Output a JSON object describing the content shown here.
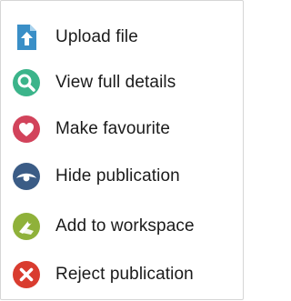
{
  "menu": {
    "items": [
      {
        "label": "Upload file",
        "icon": "upload-file-icon",
        "color": "#3a8fc7"
      },
      {
        "label": "View full details",
        "icon": "magnifier-icon",
        "color": "#3bb48a"
      },
      {
        "label": "Make favourite",
        "icon": "heart-icon",
        "color": "#d2435b"
      },
      {
        "label": "Hide publication",
        "icon": "eye-icon",
        "color": "#3b5c86"
      },
      {
        "label": "Add to workspace",
        "icon": "workspace-icon",
        "color": "#8fb13a"
      },
      {
        "label": "Reject publication",
        "icon": "close-icon",
        "color": "#d93c2f"
      }
    ]
  }
}
